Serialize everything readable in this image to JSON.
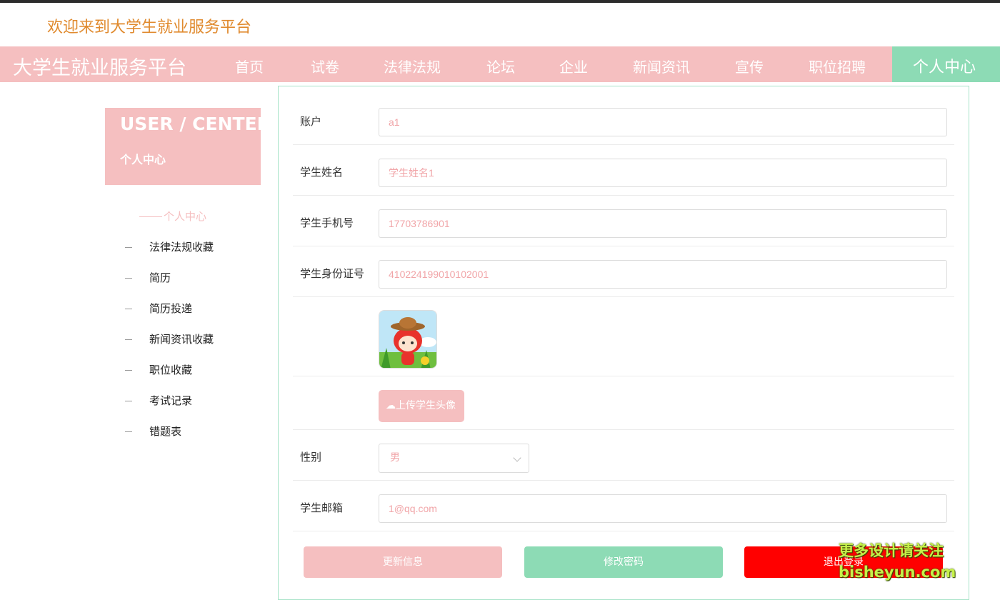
{
  "header": {
    "welcome": "欢迎来到大学生就业服务平台"
  },
  "nav": {
    "brand": "大学生就业服务平台",
    "items": [
      "首页",
      "试卷",
      "法律法规",
      "论坛",
      "企业",
      "新闻资讯",
      "宣传",
      "职位招聘"
    ],
    "active": "个人中心"
  },
  "sidebar": {
    "title": "USER / CENTER",
    "subtitle": "个人中心",
    "active_item": "个人中心",
    "items": [
      "法律法规收藏",
      "简历",
      "简历投递",
      "新闻资讯收藏",
      "职位收藏",
      "考试记录",
      "错题表"
    ]
  },
  "form": {
    "account": {
      "label": "账户",
      "value": "a1"
    },
    "name": {
      "label": "学生姓名",
      "value": "学生姓名1"
    },
    "phone": {
      "label": "学生手机号",
      "value": "17703786901"
    },
    "id_card": {
      "label": "学生身份证号",
      "value": "410224199010102001"
    },
    "upload_label": "上传学生头像",
    "gender": {
      "label": "性别",
      "value": "男"
    },
    "email": {
      "label": "学生邮箱",
      "value": "1@qq.com"
    }
  },
  "buttons": {
    "update": "更新信息",
    "change_password": "修改密码",
    "logout": "退出登录"
  },
  "watermark": {
    "line1": "更多设计请关注",
    "line2": "bisheyun.com"
  },
  "colors": {
    "pink": "#f5bfc0",
    "green": "#8ddbb5",
    "red": "#ff0000",
    "orange": "#e08a2e"
  }
}
